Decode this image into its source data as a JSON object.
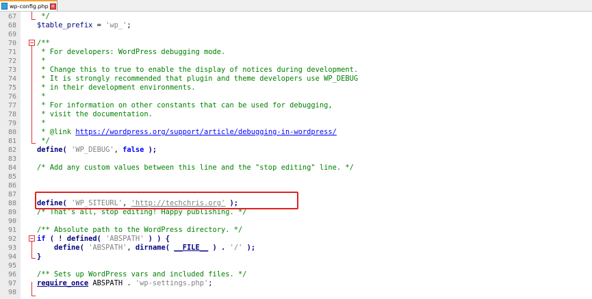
{
  "tab": {
    "filename": "wp-config.php",
    "close_glyph": "×"
  },
  "lines": [
    {
      "n": "67",
      "tokens": [
        {
          "t": " */",
          "c": "cm"
        }
      ]
    },
    {
      "n": "68",
      "tokens": [
        {
          "t": "$table_prefix",
          "c": "var"
        },
        {
          "t": " = ",
          "c": ""
        },
        {
          "t": "'wp_'",
          "c": "str"
        },
        {
          "t": ";",
          "c": ""
        }
      ]
    },
    {
      "n": "69",
      "tokens": []
    },
    {
      "n": "70",
      "tokens": [
        {
          "t": "/**",
          "c": "cm"
        }
      ]
    },
    {
      "n": "71",
      "tokens": [
        {
          "t": " * For developers: WordPress debugging mode.",
          "c": "cm"
        }
      ]
    },
    {
      "n": "72",
      "tokens": [
        {
          "t": " *",
          "c": "cm"
        }
      ]
    },
    {
      "n": "73",
      "tokens": [
        {
          "t": " * Change this to true to enable the display of notices during development.",
          "c": "cm"
        }
      ]
    },
    {
      "n": "74",
      "tokens": [
        {
          "t": " * It is strongly recommended that plugin and theme developers use WP_DEBUG",
          "c": "cm"
        }
      ]
    },
    {
      "n": "75",
      "tokens": [
        {
          "t": " * in their development environments.",
          "c": "cm"
        }
      ]
    },
    {
      "n": "76",
      "tokens": [
        {
          "t": " *",
          "c": "cm"
        }
      ]
    },
    {
      "n": "77",
      "tokens": [
        {
          "t": " * For information on other constants that can be used for debugging,",
          "c": "cm"
        }
      ]
    },
    {
      "n": "78",
      "tokens": [
        {
          "t": " * visit the documentation.",
          "c": "cm"
        }
      ]
    },
    {
      "n": "79",
      "tokens": [
        {
          "t": " *",
          "c": "cm"
        }
      ]
    },
    {
      "n": "80",
      "tokens": [
        {
          "t": " * @link ",
          "c": "cm"
        },
        {
          "t": "https://wordpress.org/support/article/debugging-in-wordpress/",
          "c": "lnk"
        }
      ]
    },
    {
      "n": "81",
      "tokens": [
        {
          "t": " */",
          "c": "cm"
        }
      ]
    },
    {
      "n": "82",
      "tokens": [
        {
          "t": "define",
          "c": "fn"
        },
        {
          "t": "( ",
          "c": "op"
        },
        {
          "t": "'WP_DEBUG'",
          "c": "str"
        },
        {
          "t": ", ",
          "c": ""
        },
        {
          "t": "false",
          "c": "kw"
        },
        {
          "t": " );",
          "c": "op"
        }
      ]
    },
    {
      "n": "83",
      "tokens": []
    },
    {
      "n": "84",
      "tokens": [
        {
          "t": "/* Add any custom values between this line and the \"stop editing\" line. */",
          "c": "cm"
        }
      ]
    },
    {
      "n": "85",
      "tokens": []
    },
    {
      "n": "86",
      "tokens": []
    },
    {
      "n": "87",
      "tokens": []
    },
    {
      "n": "88",
      "tokens": [
        {
          "t": "define",
          "c": "fn"
        },
        {
          "t": "( ",
          "c": "op"
        },
        {
          "t": "'WP_SITEURL'",
          "c": "str"
        },
        {
          "t": ", ",
          "c": ""
        },
        {
          "t": "'http://techchris.org'",
          "c": "str ul"
        },
        {
          "t": " );",
          "c": "op"
        }
      ]
    },
    {
      "n": "89",
      "tokens": [
        {
          "t": "/* That's all, stop editing! Happy publishing. */",
          "c": "cm"
        }
      ]
    },
    {
      "n": "90",
      "tokens": []
    },
    {
      "n": "91",
      "tokens": [
        {
          "t": "/** Absolute path to the WordPress directory. */",
          "c": "cm"
        }
      ]
    },
    {
      "n": "92",
      "tokens": [
        {
          "t": "if",
          "c": "kw"
        },
        {
          "t": " ( ! ",
          "c": "op"
        },
        {
          "t": "defined",
          "c": "fn"
        },
        {
          "t": "( ",
          "c": "op"
        },
        {
          "t": "'ABSPATH'",
          "c": "str"
        },
        {
          "t": " ) ) {",
          "c": "op"
        }
      ]
    },
    {
      "n": "93",
      "tokens": [
        {
          "t": "    ",
          "c": ""
        },
        {
          "t": "define",
          "c": "fn"
        },
        {
          "t": "( ",
          "c": "op"
        },
        {
          "t": "'ABSPATH'",
          "c": "str"
        },
        {
          "t": ", ",
          "c": ""
        },
        {
          "t": "dirname",
          "c": "fn"
        },
        {
          "t": "( ",
          "c": "op"
        },
        {
          "t": "__FILE__",
          "c": "fn ul"
        },
        {
          "t": " ) . ",
          "c": "op"
        },
        {
          "t": "'/'",
          "c": "str"
        },
        {
          "t": " );",
          "c": "op"
        }
      ]
    },
    {
      "n": "94",
      "tokens": [
        {
          "t": "}",
          "c": "op"
        }
      ]
    },
    {
      "n": "95",
      "tokens": []
    },
    {
      "n": "96",
      "tokens": [
        {
          "t": "/** Sets up WordPress vars and included files. */",
          "c": "cm"
        }
      ]
    },
    {
      "n": "97",
      "tokens": [
        {
          "t": "require_once",
          "c": "fn ul"
        },
        {
          "t": " ABSPATH . ",
          "c": ""
        },
        {
          "t": "'wp-settings.php'",
          "c": "str"
        },
        {
          "t": ";",
          "c": ""
        }
      ]
    },
    {
      "n": "98",
      "tokens": []
    }
  ],
  "colors": {
    "comment": "#008000",
    "keyword": "#0000ff",
    "string": "#808080",
    "highlight": "#e02020",
    "fold": "#e03030"
  }
}
